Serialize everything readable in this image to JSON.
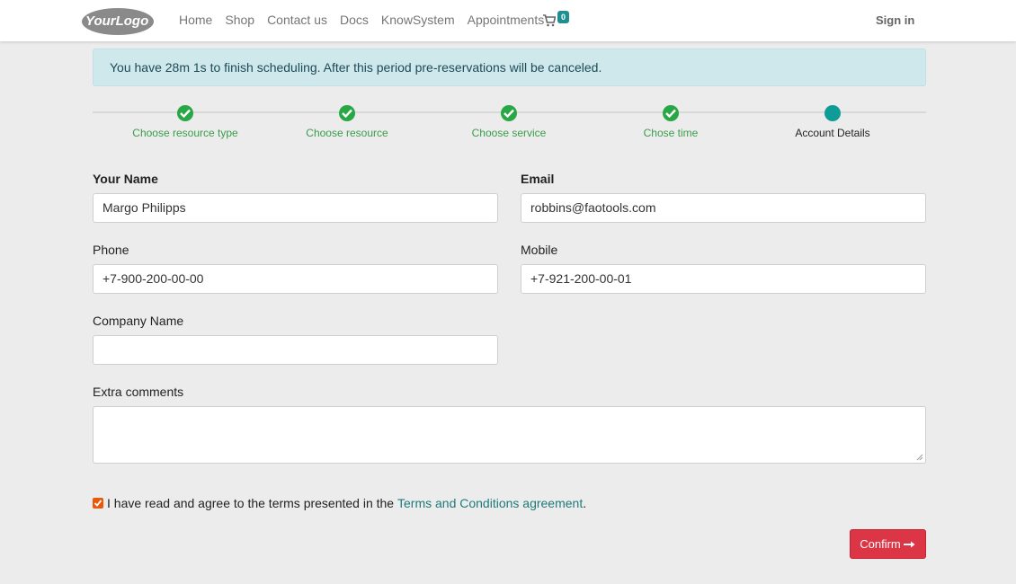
{
  "navbar": {
    "logo_text": "YourLogo",
    "links": [
      "Home",
      "Shop",
      "Contact us",
      "Docs",
      "KnowSystem",
      "Appointments"
    ],
    "cart_count": "0",
    "signin": "Sign in"
  },
  "alert": {
    "message": "You have 28m 1s to finish scheduling. After this period pre-reservations will be canceled."
  },
  "steps": [
    {
      "label": "Choose resource type",
      "status": "done"
    },
    {
      "label": "Choose resource",
      "status": "done"
    },
    {
      "label": "Choose service",
      "status": "done"
    },
    {
      "label": "Chose time",
      "status": "done"
    },
    {
      "label": "Account Details",
      "status": "current"
    }
  ],
  "form": {
    "name_label": "Your Name",
    "name_value": "Margo Philipps",
    "email_label": "Email",
    "email_value": "robbins@faotools.com",
    "phone_label": "Phone",
    "phone_value": "+7-900-200-00-00",
    "mobile_label": "Mobile",
    "mobile_value": "+7-921-200-00-01",
    "company_label": "Company Name",
    "company_value": "",
    "comments_label": "Extra comments",
    "comments_value": ""
  },
  "terms": {
    "checked": true,
    "text": "I have read and agree to the terms presented in the",
    "link": "Terms and Conditions agreement",
    "suffix": "."
  },
  "confirm_label": "Confirm",
  "colors": {
    "accent": "#1f8f8f",
    "success": "#28a745",
    "danger": "#dc3545",
    "checkbox": "#e8590c"
  }
}
